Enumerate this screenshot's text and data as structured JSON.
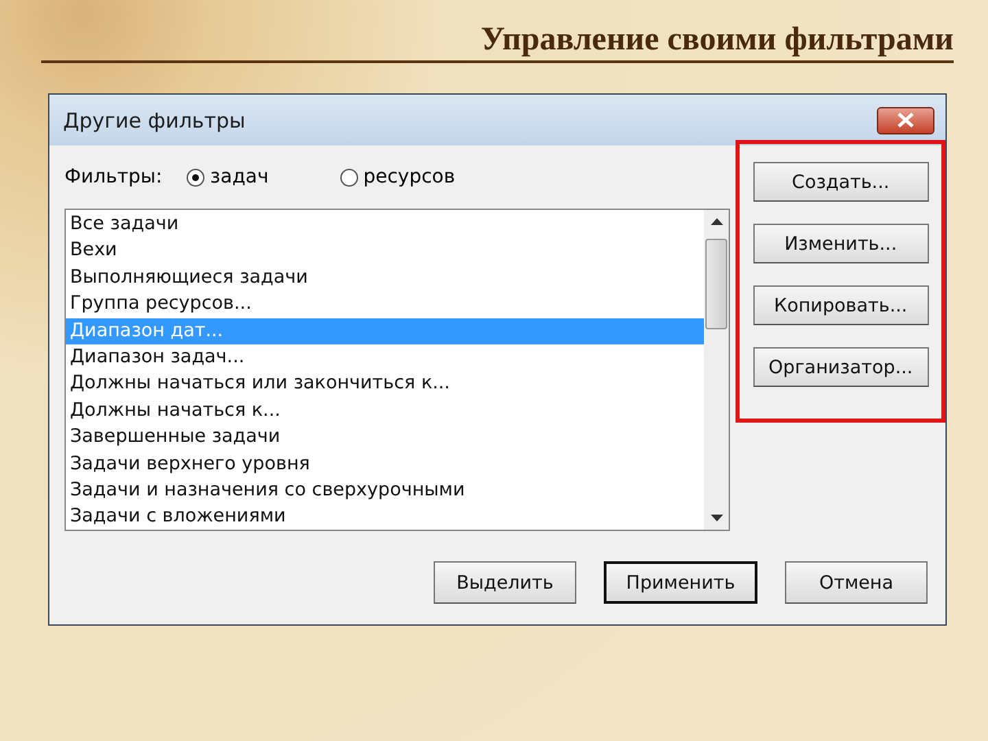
{
  "slide": {
    "title": "Управление своими фильтрами"
  },
  "dialog": {
    "title": "Другие фильтры",
    "filter_label": "Фильтры:",
    "radios": [
      {
        "label": "задач",
        "selected": true
      },
      {
        "label": "ресурсов",
        "selected": false
      }
    ],
    "list": [
      {
        "label": "Все задачи",
        "selected": false
      },
      {
        "label": "Вехи",
        "selected": false
      },
      {
        "label": "Выполняющиеся задачи",
        "selected": false
      },
      {
        "label": "Группа ресурсов...",
        "selected": false
      },
      {
        "label": "Диапазон дат...",
        "selected": true
      },
      {
        "label": "Диапазон задач...",
        "selected": false
      },
      {
        "label": "Должны начаться или закончиться к...",
        "selected": false
      },
      {
        "label": "Должны начаться к...",
        "selected": false
      },
      {
        "label": "Завершенные задачи",
        "selected": false
      },
      {
        "label": "Задачи верхнего уровня",
        "selected": false
      },
      {
        "label": "Задачи и назначения со сверхурочными",
        "selected": false
      },
      {
        "label": "Задачи с вложениями",
        "selected": false
      }
    ],
    "side_buttons": [
      "Создать...",
      "Изменить...",
      "Копировать...",
      "Организатор..."
    ],
    "buttons": [
      {
        "label": "Выделить",
        "default": false
      },
      {
        "label": "Применить",
        "default": true
      },
      {
        "label": "Отмена",
        "default": false
      }
    ]
  }
}
